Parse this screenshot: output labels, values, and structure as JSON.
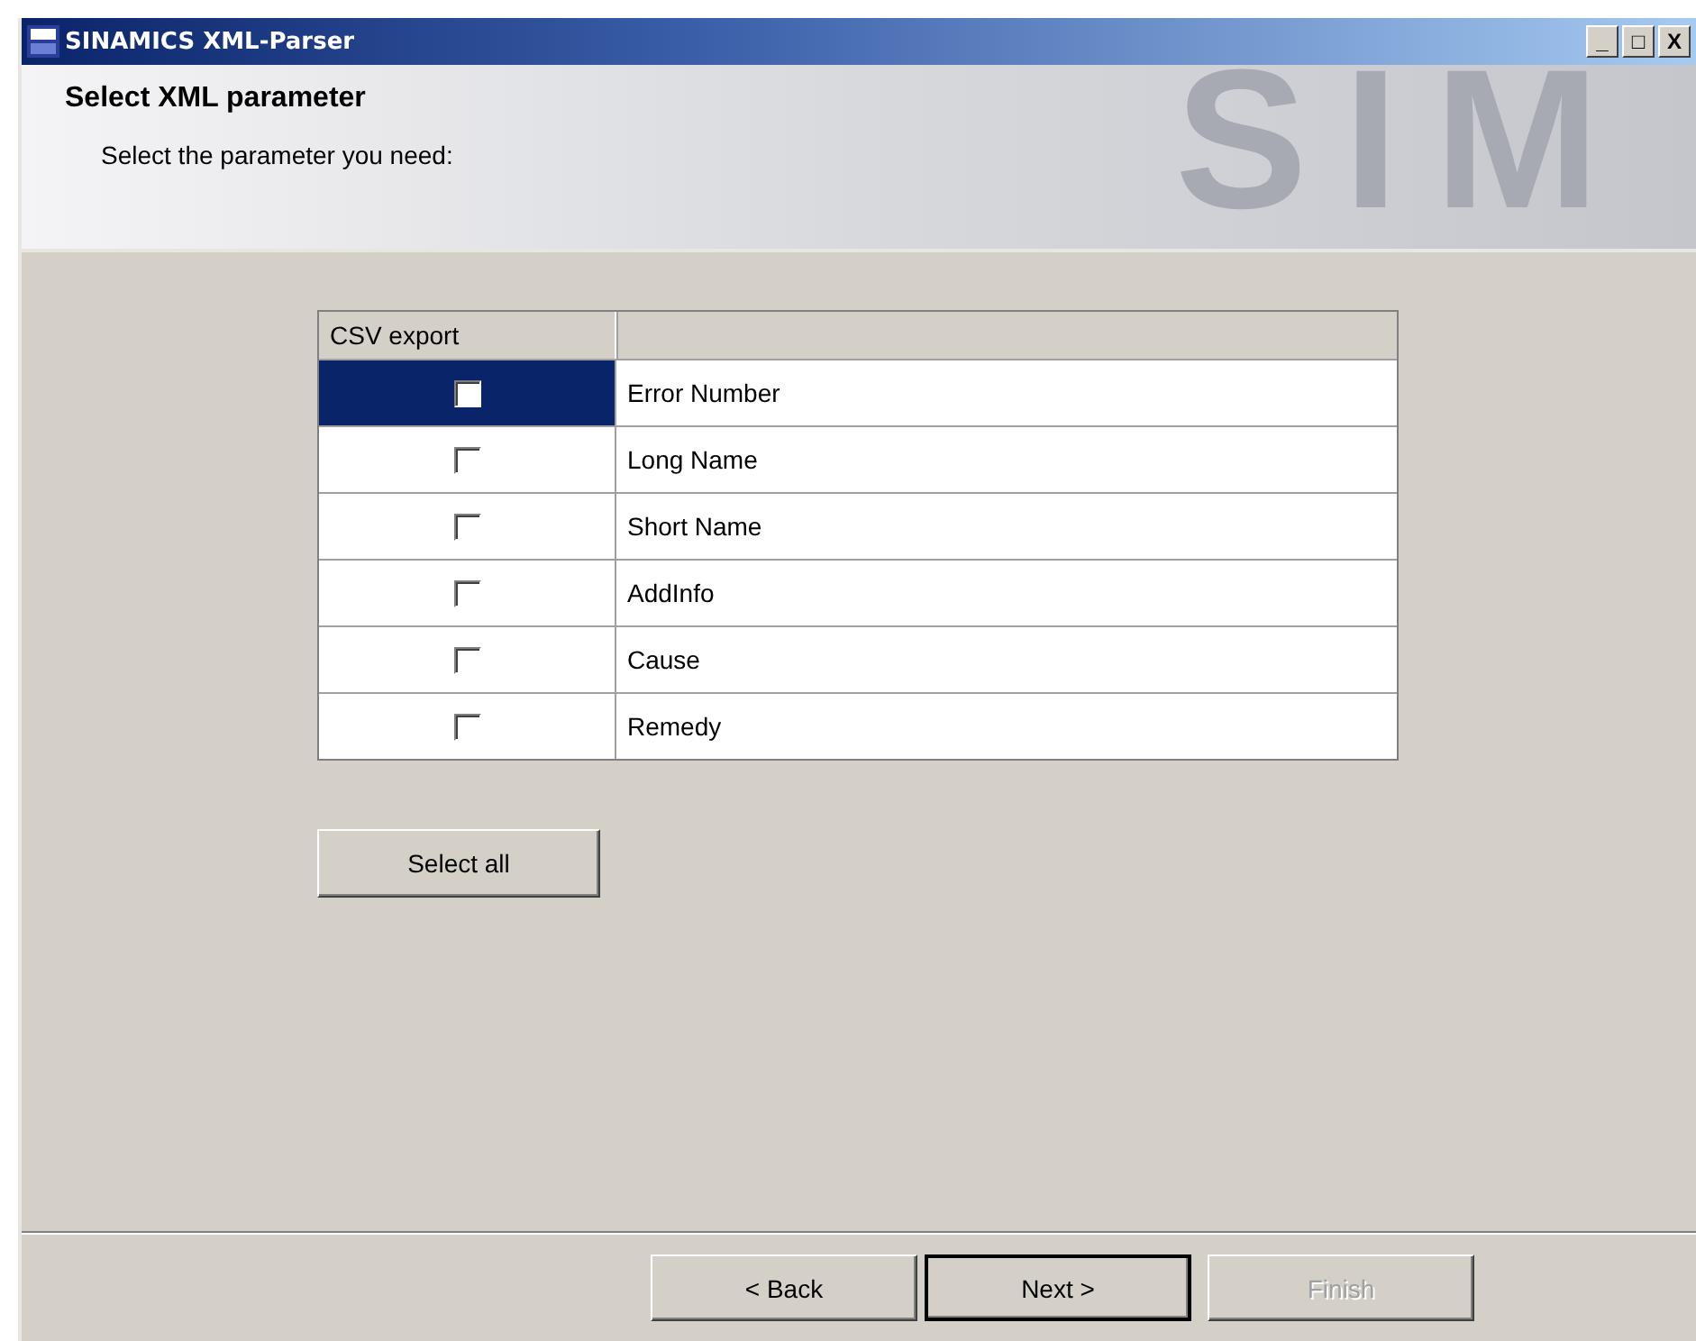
{
  "window": {
    "title": "SINAMICS XML-Parser",
    "controls": [
      "_",
      "□",
      "X"
    ]
  },
  "header": {
    "title": "Select XML parameter",
    "subtitle": "Select the parameter you need:",
    "watermark": "SIM"
  },
  "table": {
    "columns": [
      "CSV export"
    ],
    "rows": [
      {
        "label": "Error Number",
        "checked": false,
        "selected": true
      },
      {
        "label": "Long Name",
        "checked": false,
        "selected": false
      },
      {
        "label": "Short Name",
        "checked": false,
        "selected": false
      },
      {
        "label": "AddInfo",
        "checked": false,
        "selected": false
      },
      {
        "label": "Cause",
        "checked": false,
        "selected": false
      },
      {
        "label": "Remedy",
        "checked": false,
        "selected": false
      }
    ]
  },
  "select_all": {
    "label": "Select all"
  },
  "buttons": [
    {
      "label": "< Back",
      "disabled": false,
      "default": false
    },
    {
      "label": "Next >",
      "disabled": false,
      "default": true
    },
    {
      "label": "Finish",
      "disabled": true,
      "default": false
    }
  ]
}
